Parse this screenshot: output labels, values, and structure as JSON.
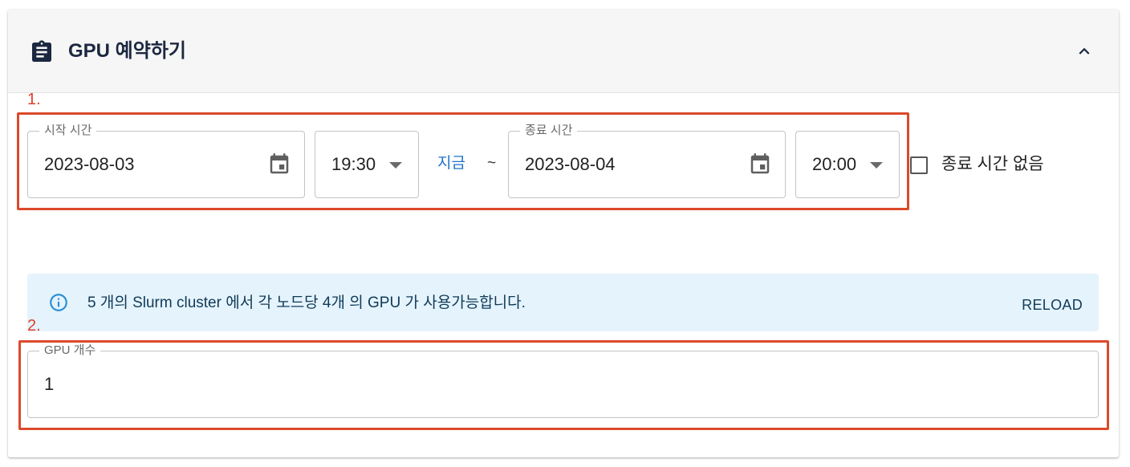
{
  "header": {
    "title": "GPU 예약하기",
    "icon": "clipboard-icon",
    "collapse_icon": "chevron-up-icon"
  },
  "markers": {
    "first": "1.",
    "second": "2."
  },
  "start": {
    "label": "시작 시간",
    "date": "2023-08-03",
    "time": "19:30"
  },
  "now_label": "지금",
  "separator": "~",
  "end": {
    "label": "종료 시간",
    "date": "2023-08-04",
    "time": "20:00"
  },
  "no_end_checkbox": {
    "label": "종료 시간 없음",
    "checked": false
  },
  "alert": {
    "text": "5 개의 Slurm cluster 에서 각 노드당 4개 의 GPU 가 사용가능합니다.",
    "action": "RELOAD",
    "icon": "info-icon"
  },
  "gpu_count": {
    "label": "GPU 개수",
    "value": "1"
  },
  "colors": {
    "header_title": "#1c2840",
    "link": "#1d72c7",
    "alert_bg": "#e5f3fc",
    "highlight_box": "#db4a2b"
  }
}
